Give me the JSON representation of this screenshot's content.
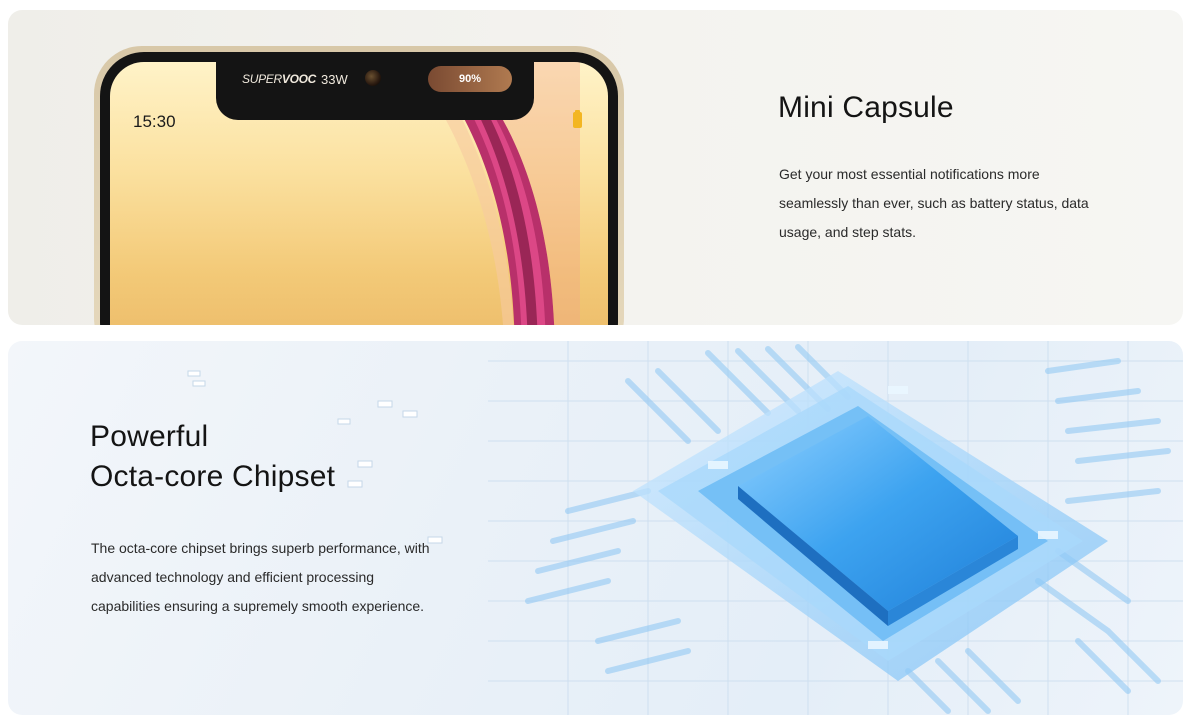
{
  "feature1": {
    "title": "Mini Capsule",
    "description": "Get your most essential notifications more seamlessly than ever, such as battery status, data usage, and step stats.",
    "phone": {
      "time": "15:30",
      "charge_brand_prefix": "SUPER",
      "charge_brand_suffix": "VOOC",
      "charge_wattage": "33W",
      "battery_percent": "90%"
    }
  },
  "feature2": {
    "title_line1": "Powerful",
    "title_line2": "Octa-core Chipset",
    "description": "The octa-core chipset brings superb performance, with advanced technology and efficient processing capabilities ensuring a supremely smooth experience."
  },
  "colors": {
    "battery": "#f3b622",
    "chip_blue": "#3da3f0",
    "card1_bg": "#efeee9",
    "card2_bg": "#eaf1f8"
  }
}
